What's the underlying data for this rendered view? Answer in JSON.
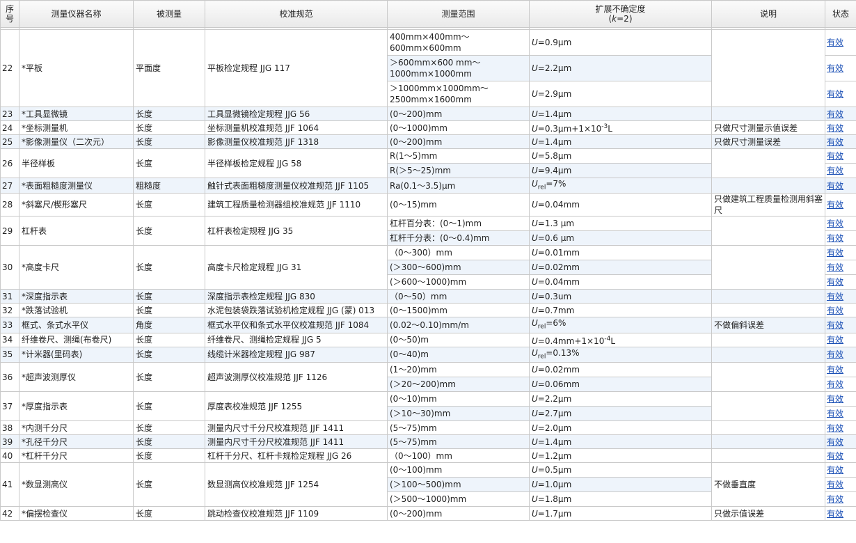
{
  "headers": {
    "idx": "序号",
    "name": "测量仪器名称",
    "measurand": "被测量",
    "spec": "校准规范",
    "range": "测量范围",
    "uncert": "扩展不确定度",
    "uncert_k_open": "(",
    "uncert_k_var": "k",
    "uncert_k_close": "=2)",
    "note": "说明",
    "status": "状态"
  },
  "status_label": "有效",
  "rows": [
    {
      "idx": "22",
      "name": "*平板",
      "measurand": "平面度",
      "spec": "平板检定规程 JJG 117",
      "note": "",
      "subs": [
        {
          "range": "400mm×400mm～\n600mm×600mm",
          "u_prefix": "U",
          "u_sub": "",
          "u_val": "=0.9μm",
          "u_sup": "",
          "u_tail": ""
        },
        {
          "range": "＞600mm×600 mm～\n1000mm×1000mm",
          "u_prefix": "U",
          "u_sub": "",
          "u_val": "=2.2μm",
          "u_sup": "",
          "u_tail": ""
        },
        {
          "range": "＞1000mm×1000mm～\n2500mm×1600mm",
          "u_prefix": "U",
          "u_sub": "",
          "u_val": "=2.9μm",
          "u_sup": "",
          "u_tail": ""
        }
      ]
    },
    {
      "idx": "23",
      "name": "*工具显微镜",
      "measurand": "长度",
      "spec": "工具显微镜检定规程 JJG 56",
      "note": "",
      "subs": [
        {
          "range": "(0～200)mm",
          "u_prefix": "U",
          "u_sub": "",
          "u_val": "=1.4μm",
          "u_sup": "",
          "u_tail": ""
        }
      ]
    },
    {
      "idx": "24",
      "name": "*坐标测量机",
      "measurand": "长度",
      "spec": "坐标测量机校准规范 JJF 1064",
      "note": "只做尺寸测量示值误差",
      "subs": [
        {
          "range": "(0～1000)mm",
          "u_prefix": "U",
          "u_sub": "",
          "u_val": "=0.3μm+1×10",
          "u_sup": "-3",
          "u_tail": "L"
        }
      ]
    },
    {
      "idx": "25",
      "name": "*影像测量仪（二次元）",
      "measurand": "长度",
      "spec": "影像测量仪校准规范 JJF 1318",
      "note": "只做尺寸测量误差",
      "subs": [
        {
          "range": "(0～200)mm",
          "u_prefix": "U",
          "u_sub": "",
          "u_val": "=1.4μm",
          "u_sup": "",
          "u_tail": ""
        }
      ]
    },
    {
      "idx": "26",
      "name": "半径样板",
      "measurand": "长度",
      "spec": "半径样板检定规程 JJG 58",
      "note": "",
      "subs": [
        {
          "range": "R(1～5)mm",
          "u_prefix": "U",
          "u_sub": "",
          "u_val": "=5.8μm",
          "u_sup": "",
          "u_tail": ""
        },
        {
          "range": "R(＞5～25)mm",
          "u_prefix": "U",
          "u_sub": "",
          "u_val": "=9.4μm",
          "u_sup": "",
          "u_tail": ""
        }
      ]
    },
    {
      "idx": "27",
      "name": "*表面粗糙度测量仪",
      "measurand": "粗糙度",
      "spec": "触针式表面粗糙度测量仪校准规范 JJF 1105",
      "note": "",
      "subs": [
        {
          "range": "Ra(0.1～3.5)μm",
          "u_prefix": "U",
          "u_sub": "rel",
          "u_val": "=7%",
          "u_sup": "",
          "u_tail": ""
        }
      ]
    },
    {
      "idx": "28",
      "name": "*斜塞尺/楔形塞尺",
      "measurand": "长度",
      "spec": "建筑工程质量检测器组校准规范 JJF 1110",
      "note": "只做建筑工程质量检测用斜塞尺",
      "subs": [
        {
          "range": "(0～15)mm",
          "u_prefix": "U",
          "u_sub": "",
          "u_val": "=0.04mm",
          "u_sup": "",
          "u_tail": ""
        }
      ]
    },
    {
      "idx": "29",
      "name": "杠杆表",
      "measurand": "长度",
      "spec": "杠杆表检定规程 JJG 35",
      "note": "",
      "subs": [
        {
          "range": "杠杆百分表：(0～1)mm",
          "u_prefix": "U",
          "u_sub": "",
          "u_val": "=1.3 μm",
          "u_sup": "",
          "u_tail": ""
        },
        {
          "range": "杠杆千分表：(0～0.4)mm",
          "u_prefix": "U",
          "u_sub": "",
          "u_val": "=0.6 μm",
          "u_sup": "",
          "u_tail": ""
        }
      ]
    },
    {
      "idx": "30",
      "name": "*高度卡尺",
      "measurand": "长度",
      "spec": "高度卡尺检定规程 JJG 31",
      "note": "",
      "subs": [
        {
          "range": "（0～300）mm",
          "u_prefix": "U",
          "u_sub": "",
          "u_val": "=0.01mm",
          "u_sup": "",
          "u_tail": ""
        },
        {
          "range": "(＞300～600)mm",
          "u_prefix": "U",
          "u_sub": "",
          "u_val": "=0.02mm",
          "u_sup": "",
          "u_tail": ""
        },
        {
          "range": "(＞600～1000)mm",
          "u_prefix": "U",
          "u_sub": "",
          "u_val": "=0.04mm",
          "u_sup": "",
          "u_tail": ""
        }
      ]
    },
    {
      "idx": "31",
      "name": "*深度指示表",
      "measurand": "长度",
      "spec": "深度指示表检定规程 JJG 830",
      "note": "",
      "subs": [
        {
          "range": "（0～50）mm",
          "u_prefix": "U",
          "u_sub": "",
          "u_val": "=0.3um",
          "u_sup": "",
          "u_tail": ""
        }
      ]
    },
    {
      "idx": "32",
      "name": "*跌落试验机",
      "measurand": "长度",
      "spec": "水泥包装袋跌落试验机检定规程 JJG (蒙) 013",
      "note": "",
      "subs": [
        {
          "range": "(0～1500)mm",
          "u_prefix": "U",
          "u_sub": "",
          "u_val": "=0.7mm",
          "u_sup": "",
          "u_tail": ""
        }
      ]
    },
    {
      "idx": "33",
      "name": "框式、条式水平仪",
      "measurand": "角度",
      "spec": "框式水平仪和条式水平仪校准规范 JJF 1084",
      "note": "不做偏斜误差",
      "subs": [
        {
          "range": "(0.02～0.10)mm/m",
          "u_prefix": "U",
          "u_sub": "rel",
          "u_val": "=6%",
          "u_sup": "",
          "u_tail": ""
        }
      ]
    },
    {
      "idx": "34",
      "name": "纤维卷尺、测绳(布卷尺)",
      "measurand": "长度",
      "spec": "纤维卷尺、测绳检定规程 JJG 5",
      "note": "",
      "subs": [
        {
          "range": "(0～50)m",
          "u_prefix": "U",
          "u_sub": "",
          "u_val": "=0.4mm+1×10",
          "u_sup": "-4",
          "u_tail": "L"
        }
      ]
    },
    {
      "idx": "35",
      "name": "*计米器(里码表)",
      "measurand": "长度",
      "spec": "线缆计米器检定规程 JJG 987",
      "note": "",
      "subs": [
        {
          "range": "(0～40)m",
          "u_prefix": "U",
          "u_sub": "rel",
          "u_val": "=0.13%",
          "u_sup": "",
          "u_tail": ""
        }
      ]
    },
    {
      "idx": "36",
      "name": "*超声波测厚仪",
      "measurand": "长度",
      "spec": "超声波测厚仪校准规范 JJF 1126",
      "note": "",
      "subs": [
        {
          "range": "(1～20)mm",
          "u_prefix": "U",
          "u_sub": "",
          "u_val": "=0.02mm",
          "u_sup": "",
          "u_tail": ""
        },
        {
          "range": "(＞20～200)mm",
          "u_prefix": "U",
          "u_sub": "",
          "u_val": "=0.06mm",
          "u_sup": "",
          "u_tail": ""
        }
      ]
    },
    {
      "idx": "37",
      "name": "*厚度指示表",
      "measurand": "长度",
      "spec": "厚度表校准规范 JJF 1255",
      "note": "",
      "subs": [
        {
          "range": "(0～10)mm",
          "u_prefix": "U",
          "u_sub": "",
          "u_val": "=2.2μm",
          "u_sup": "",
          "u_tail": ""
        },
        {
          "range": "(＞10～30)mm",
          "u_prefix": "U",
          "u_sub": "",
          "u_val": "=2.7μm",
          "u_sup": "",
          "u_tail": ""
        }
      ]
    },
    {
      "idx": "38",
      "name": "*内测千分尺",
      "measurand": "长度",
      "spec": "测量内尺寸千分尺校准规范 JJF 1411",
      "note": "",
      "subs": [
        {
          "range": "(5～75)mm",
          "u_prefix": "U",
          "u_sub": "",
          "u_val": "=2.0μm",
          "u_sup": "",
          "u_tail": ""
        }
      ]
    },
    {
      "idx": "39",
      "name": "*孔径千分尺",
      "measurand": "长度",
      "spec": "测量内尺寸千分尺校准规范 JJF 1411",
      "note": "",
      "subs": [
        {
          "range": "(5～75)mm",
          "u_prefix": "U",
          "u_sub": "",
          "u_val": "=1.4μm",
          "u_sup": "",
          "u_tail": ""
        }
      ]
    },
    {
      "idx": "40",
      "name": "*杠杆千分尺",
      "measurand": "长度",
      "spec": "杠杆千分尺、杠杆卡规检定规程 JJG 26",
      "note": "",
      "subs": [
        {
          "range": "（0～100）mm",
          "u_prefix": "U",
          "u_sub": "",
          "u_val": "=1.2μm",
          "u_sup": "",
          "u_tail": ""
        }
      ]
    },
    {
      "idx": "41",
      "name": "*数显测高仪",
      "measurand": "长度",
      "spec": "数显测高仪校准规范 JJF 1254",
      "note": "不做垂直度",
      "subs": [
        {
          "range": "(0～100)mm",
          "u_prefix": "U",
          "u_sub": "",
          "u_val": "=0.5μm",
          "u_sup": "",
          "u_tail": ""
        },
        {
          "range": "(＞100～500)mm",
          "u_prefix": "U",
          "u_sub": "",
          "u_val": "=1.0μm",
          "u_sup": "",
          "u_tail": ""
        },
        {
          "range": "(＞500～1000)mm",
          "u_prefix": "U",
          "u_sub": "",
          "u_val": "=1.8μm",
          "u_sup": "",
          "u_tail": ""
        }
      ]
    },
    {
      "idx": "42",
      "name": "*偏摆检查仪",
      "measurand": "长度",
      "spec": "跳动检查仪校准规范 JJF 1109",
      "note": "只做示值误差",
      "subs": [
        {
          "range": "(0～200)mm",
          "u_prefix": "U",
          "u_sub": "",
          "u_val": "=1.7μm",
          "u_sup": "",
          "u_tail": ""
        }
      ]
    }
  ]
}
